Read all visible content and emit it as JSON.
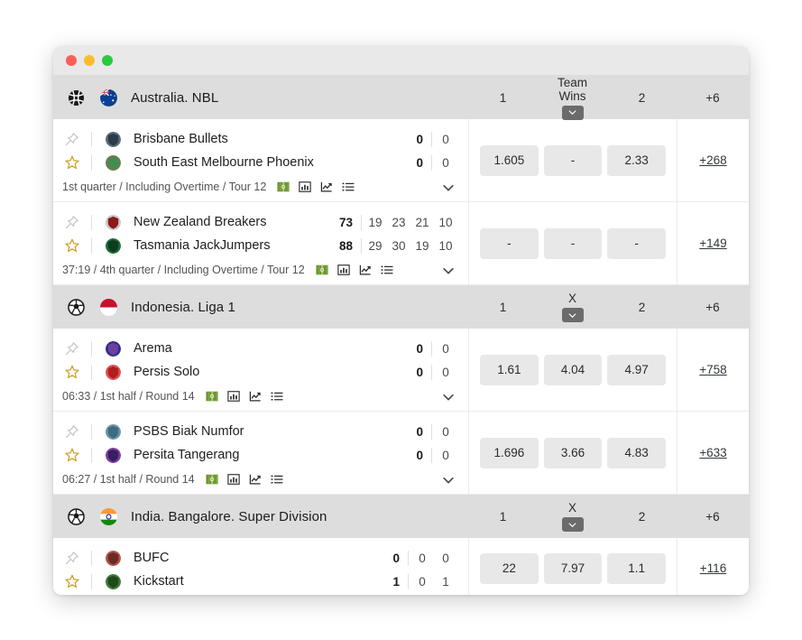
{
  "window": {
    "traffic_lights": [
      "close",
      "minimize",
      "maximize"
    ]
  },
  "sections": [
    {
      "id": "australia-nbl",
      "sport_icon": "basketball-icon",
      "flag": "australia-flag",
      "name": "Australia. NBL",
      "columns": {
        "c1": "1",
        "c2_line1": "Team",
        "c2_line2": "Wins",
        "c3": "2",
        "extra": "+6"
      },
      "has_chevron_button": true,
      "matches": [
        {
          "pin_icon": "pin-icon",
          "star_icon": "star-icon",
          "home": {
            "logo": "brisbane-bullets-logo",
            "name": "Brisbane Bullets",
            "score": "0",
            "periods": [
              "0"
            ]
          },
          "away": {
            "logo": "south-east-melbourne-phoenix-logo",
            "name": "South East Melbourne Phoenix",
            "score": "0",
            "periods": [
              "0"
            ]
          },
          "status": "1st quarter / Including Overtime / Tour 12",
          "status_icons": [
            "pitch-icon",
            "bar-chart-icon",
            "line-chart-icon",
            "list-icon"
          ],
          "odds": [
            "1.605",
            "-",
            "2.33"
          ],
          "extra": "+268"
        },
        {
          "pin_icon": "pin-icon",
          "star_icon": "star-icon",
          "home": {
            "logo": "new-zealand-breakers-logo",
            "name": "New Zealand Breakers",
            "score": "73",
            "periods": [
              "19",
              "23",
              "21",
              "10"
            ]
          },
          "away": {
            "logo": "tasmania-jackjumpers-logo",
            "name": "Tasmania JackJumpers",
            "score": "88",
            "periods": [
              "29",
              "30",
              "19",
              "10"
            ]
          },
          "status": "37:19 / 4th quarter / Including Overtime / Tour 12",
          "status_icons": [
            "pitch-icon",
            "bar-chart-icon",
            "line-chart-icon",
            "list-icon"
          ],
          "odds": [
            "-",
            "-",
            "-"
          ],
          "extra": "+149"
        }
      ]
    },
    {
      "id": "indonesia-liga-1",
      "sport_icon": "football-icon",
      "flag": "indonesia-flag",
      "name": "Indonesia. Liga 1",
      "columns": {
        "c1": "1",
        "c2_line1": "",
        "c2_line2": "X",
        "c3": "2",
        "extra": "+6"
      },
      "has_chevron_button": true,
      "matches": [
        {
          "pin_icon": "pin-icon",
          "star_icon": "star-icon",
          "home": {
            "logo": "arema-logo",
            "name": "Arema",
            "score": "0",
            "periods": [
              "0"
            ]
          },
          "away": {
            "logo": "persis-solo-logo",
            "name": "Persis Solo",
            "score": "0",
            "periods": [
              "0"
            ]
          },
          "status": "06:33 / 1st half / Round 14",
          "status_icons": [
            "pitch-icon",
            "bar-chart-icon",
            "line-chart-icon",
            "list-icon"
          ],
          "odds": [
            "1.61",
            "4.04",
            "4.97"
          ],
          "extra": "+758"
        },
        {
          "pin_icon": "pin-icon",
          "star_icon": "star-icon",
          "home": {
            "logo": "psbs-biak-numfor-logo",
            "name": "PSBS Biak Numfor",
            "score": "0",
            "periods": [
              "0"
            ]
          },
          "away": {
            "logo": "persita-tangerang-logo",
            "name": "Persita Tangerang",
            "score": "0",
            "periods": [
              "0"
            ]
          },
          "status": "06:27 / 1st half / Round 14",
          "status_icons": [
            "pitch-icon",
            "bar-chart-icon",
            "line-chart-icon",
            "list-icon"
          ],
          "odds": [
            "1.696",
            "3.66",
            "4.83"
          ],
          "extra": "+633"
        }
      ]
    },
    {
      "id": "india-bangalore-super-division",
      "sport_icon": "football-icon",
      "flag": "india-flag",
      "name": "India. Bangalore. Super Division",
      "columns": {
        "c1": "1",
        "c2_line1": "",
        "c2_line2": "X",
        "c3": "2",
        "extra": "+6"
      },
      "has_chevron_button": true,
      "matches": [
        {
          "pin_icon": "pin-icon",
          "star_icon": "star-icon",
          "home": {
            "logo": "bufc-logo",
            "name": "BUFC",
            "score": "0",
            "periods": [
              "0",
              "0"
            ]
          },
          "away": {
            "logo": "kickstart-logo",
            "name": "Kickstart",
            "score": "1",
            "periods": [
              "0",
              "1"
            ]
          },
          "status": "",
          "status_icons": [],
          "odds": [
            "22",
            "7.97",
            "1.1"
          ],
          "extra": "+116"
        }
      ]
    }
  ],
  "colors": {
    "header_bg": "#dddddd",
    "odds_button_bg": "#e8e8e8",
    "chevron_button_bg": "#6b6b6b",
    "star_outline": "#c9a227",
    "pitch_icon_green": "#5b8a2a",
    "titlebar_bg": "#e9e9e9"
  }
}
